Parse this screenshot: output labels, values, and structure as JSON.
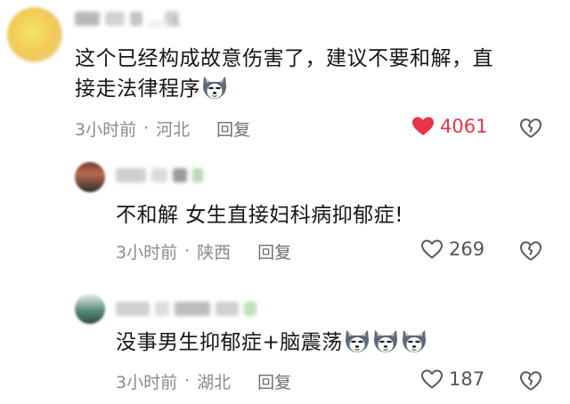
{
  "comments": [
    {
      "name_hint": "…强",
      "text_line1": "这个已经构成故意伤害了，建议不要和解，直",
      "text_line2": "接走法律程序",
      "emojis": [
        "husky-emoji"
      ],
      "time": "3小时前",
      "location": "河北",
      "reply_label": "回复",
      "likes": "4061",
      "liked": true
    },
    {
      "text_line1": "不和解 女生直接妇科病抑郁症!",
      "time": "3小时前",
      "location": "陕西",
      "reply_label": "回复",
      "likes": "269",
      "liked": false
    },
    {
      "text_line1": "没事男生抑郁症+脑震荡",
      "emojis": [
        "husky-emoji",
        "husky-emoji",
        "husky-emoji"
      ],
      "time": "3小时前",
      "location": "湖北",
      "reply_label": "回复",
      "likes": "187",
      "liked": false
    }
  ],
  "colors": {
    "like_active": "#e8334a",
    "meta": "#8a8a8a",
    "text": "#161616"
  }
}
